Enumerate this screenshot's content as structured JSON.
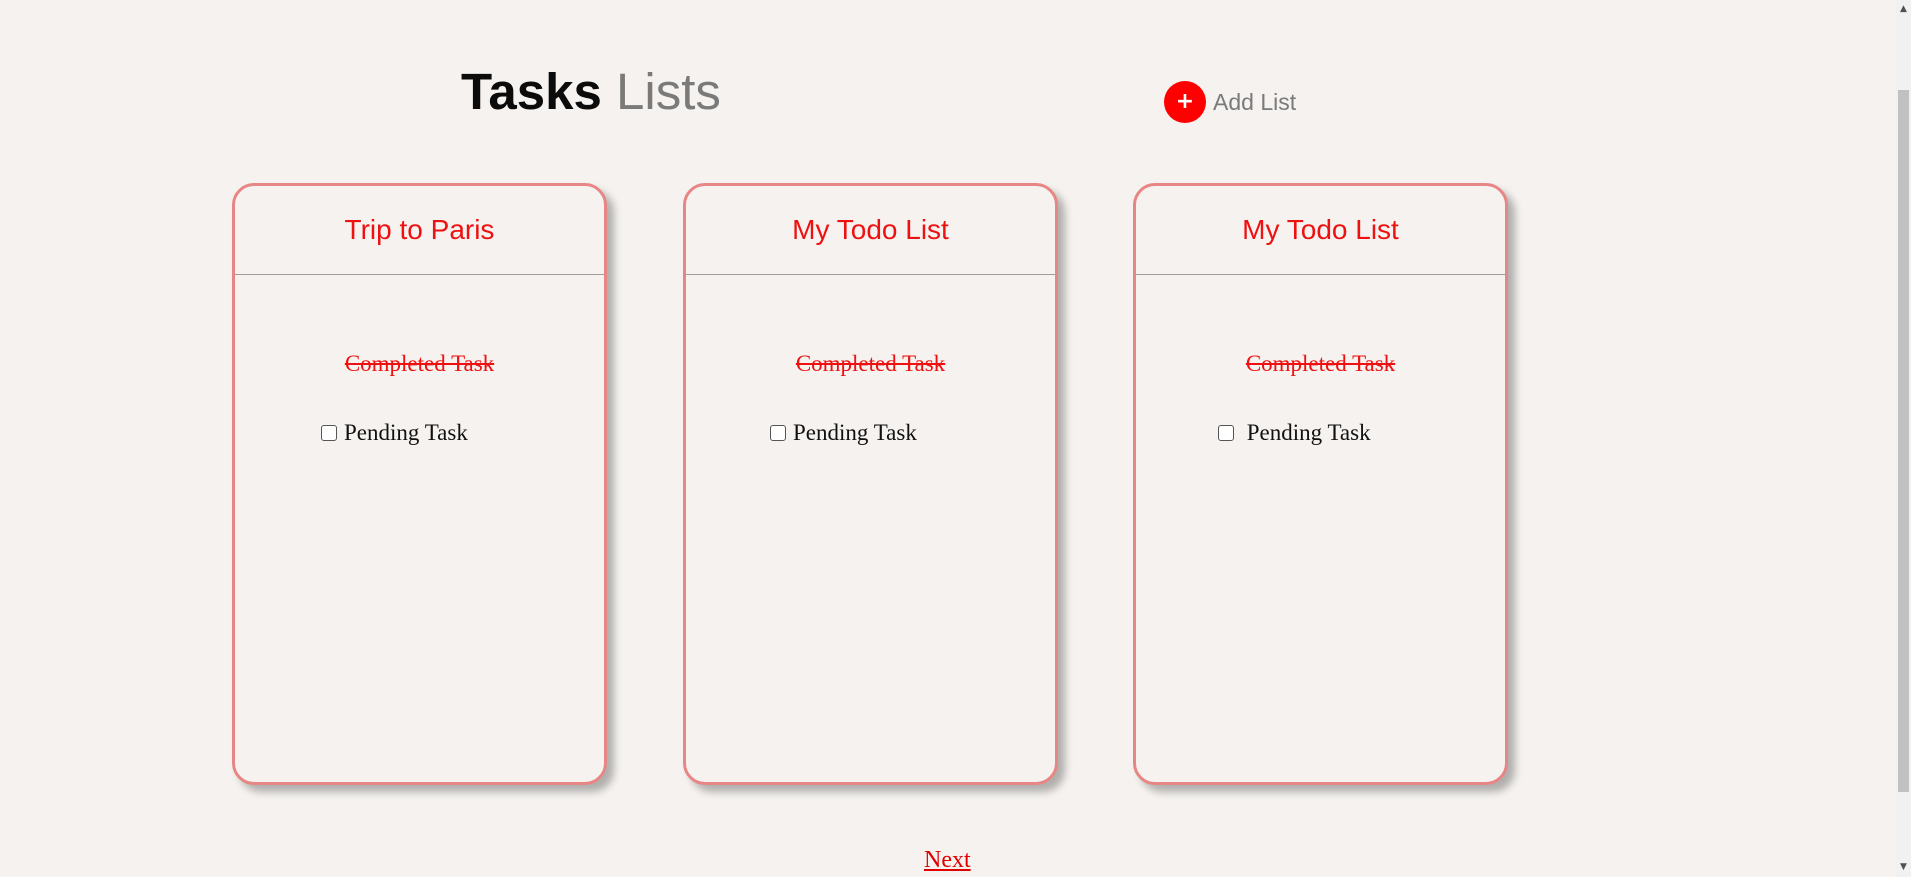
{
  "header": {
    "title_strong": "Tasks",
    "title_light": " Lists",
    "add_button_icon": "+",
    "add_label": "Add List"
  },
  "lists": [
    {
      "title": "Trip to Paris",
      "completed_task": "Completed Task",
      "pending_task": "Pending Task",
      "pending_checked": false
    },
    {
      "title": "My Todo List",
      "completed_task": "Completed Task",
      "pending_task": "Pending Task",
      "pending_checked": false
    },
    {
      "title": "My Todo List",
      "completed_task": "Completed Task",
      "pending_task": " Pending Task",
      "pending_checked": false
    }
  ],
  "pagination": {
    "next_label": "Next"
  },
  "scrollbar": {
    "up_icon": "▲",
    "down_icon": "▼"
  },
  "colors": {
    "accent": "#ff0000",
    "card_border": "#e88686",
    "background": "#f5f2ef"
  }
}
